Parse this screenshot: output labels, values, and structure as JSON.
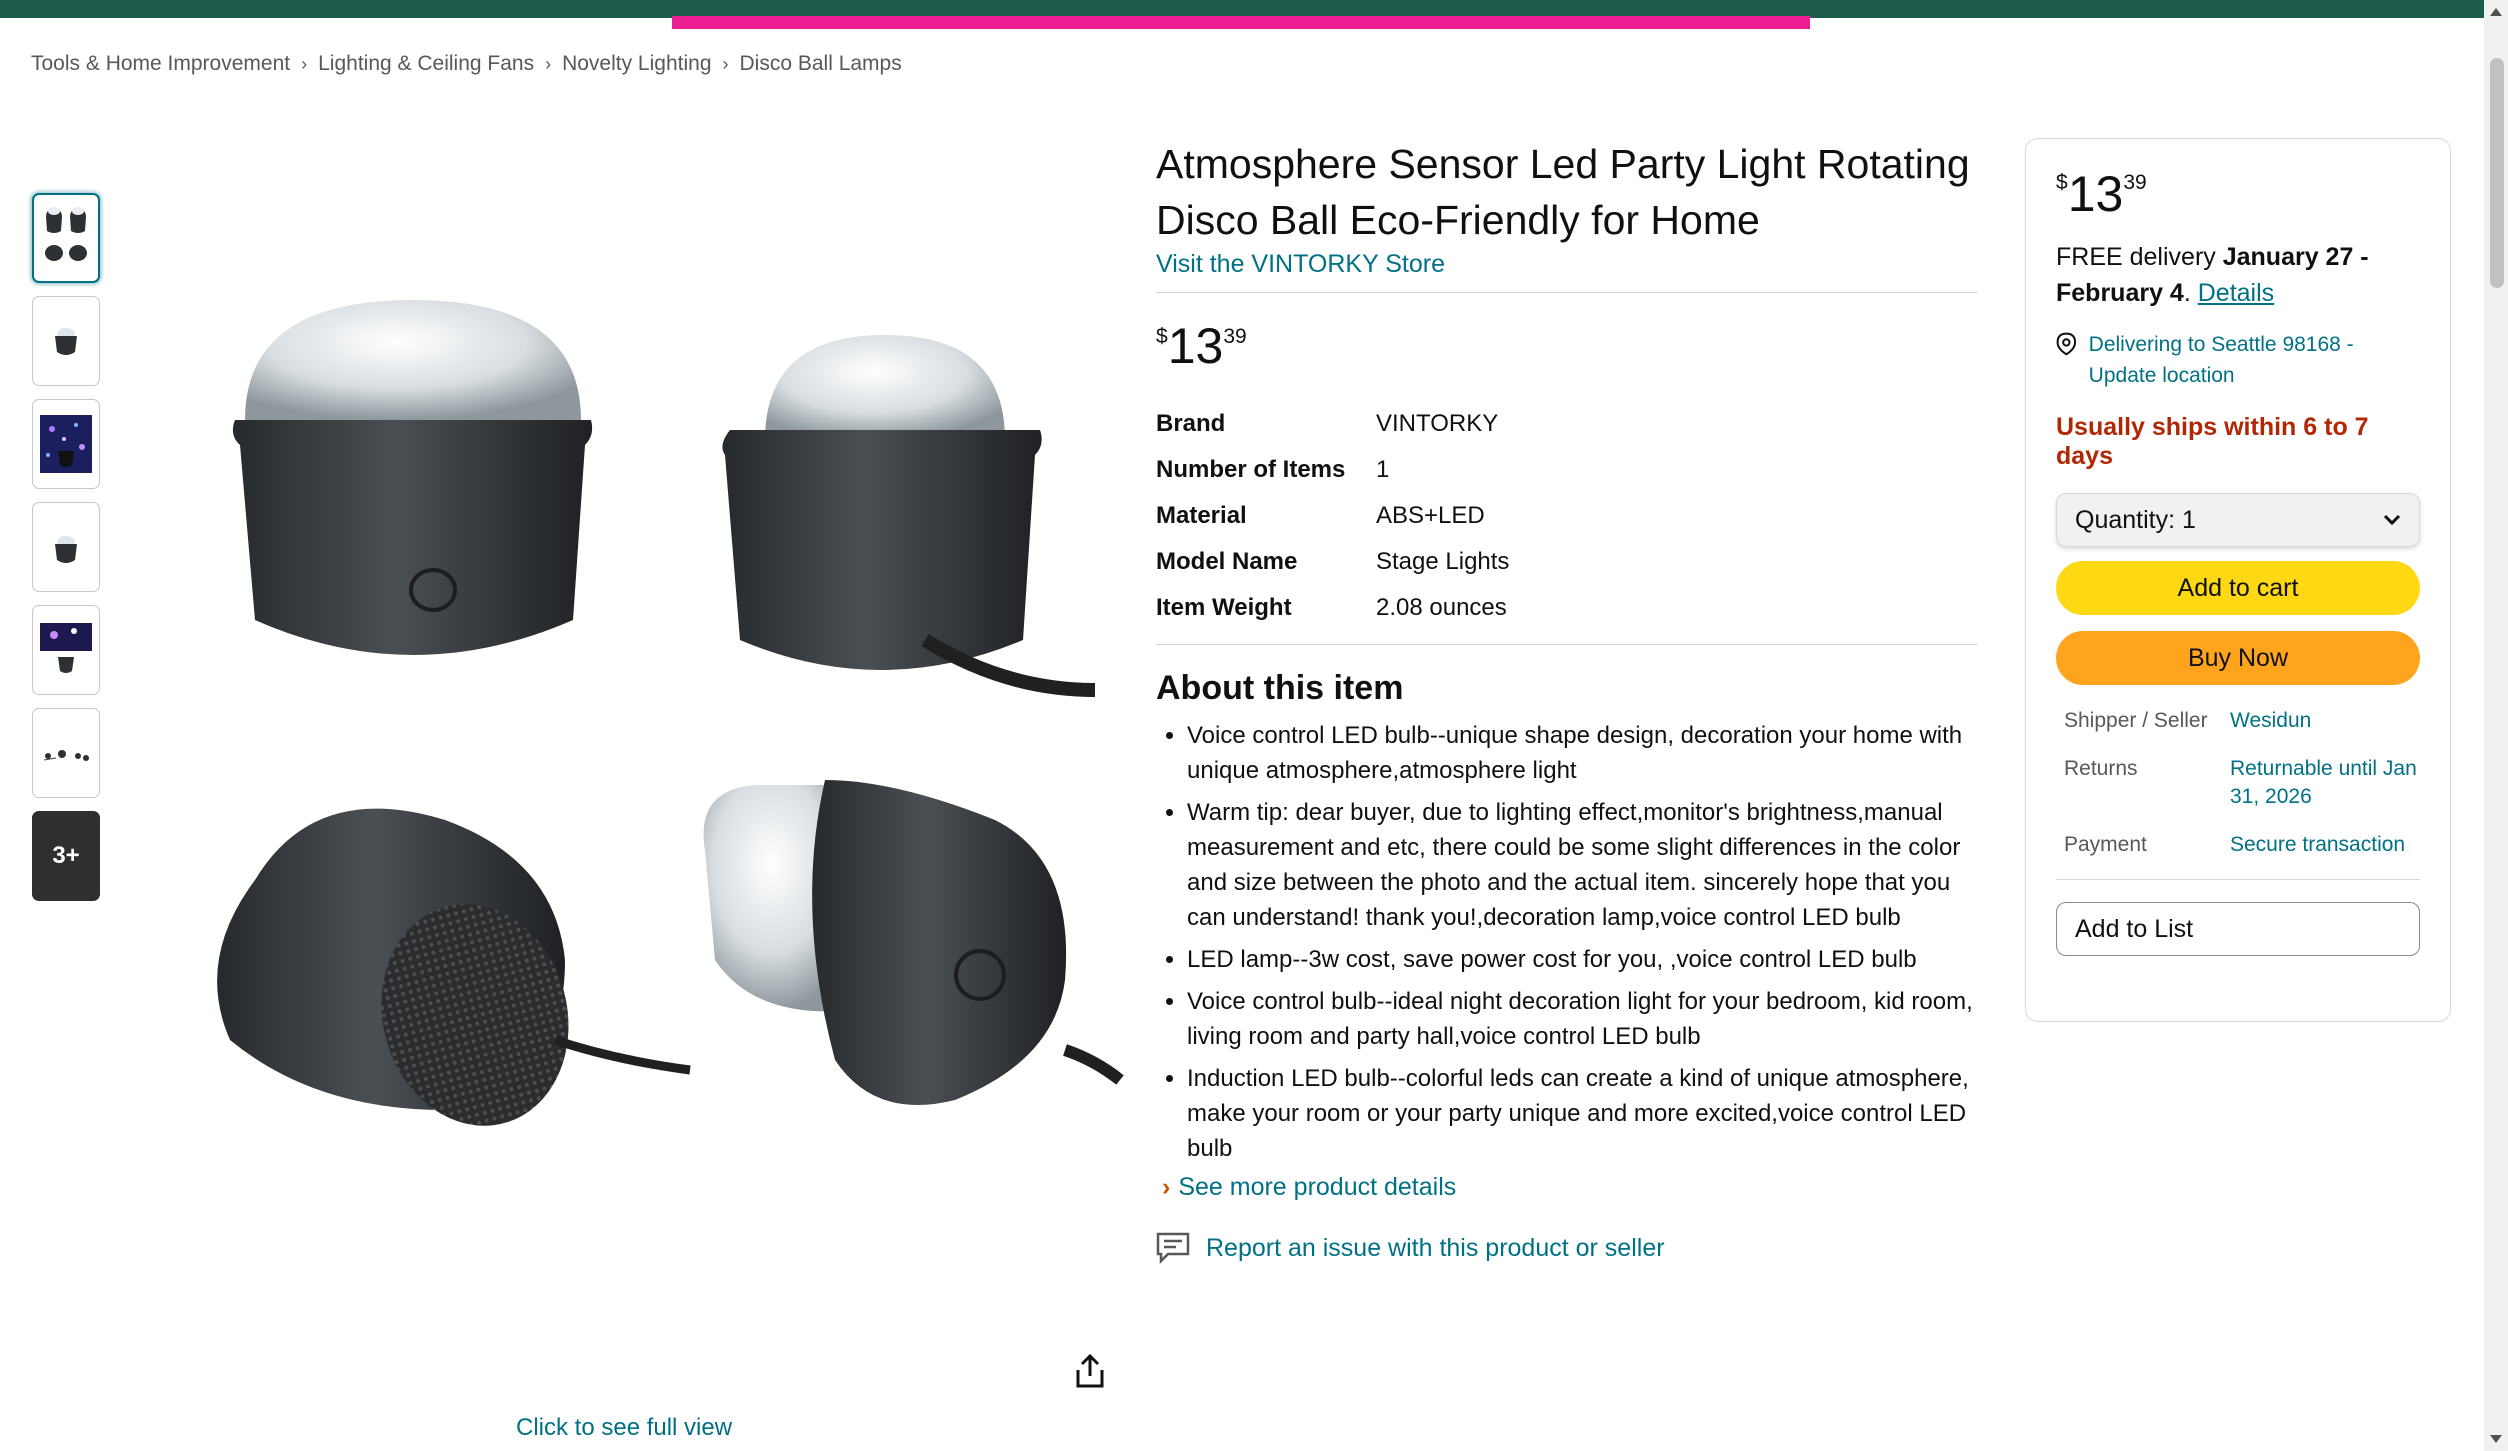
{
  "colors": {
    "top_bar": "#1d5c4a",
    "top_accent": "#ec1d92",
    "link": "#007185",
    "cart_button": "#ffd814",
    "buy_button": "#ffa41c",
    "ships_text": "#b12704"
  },
  "breadcrumb": [
    "Tools & Home Improvement",
    "Lighting & Ceiling Fans",
    "Novelty Lighting",
    "Disco Ball Lamps"
  ],
  "gallery": {
    "thumbnail_more_label": "3+",
    "click_full_view": "Click to see full view"
  },
  "product": {
    "title": "Atmosphere Sensor Led Party Light Rotating Disco Ball Eco-Friendly for Home",
    "store_link": "Visit the VINTORKY Store",
    "price": {
      "symbol": "$",
      "whole": "13",
      "fraction": "39"
    },
    "specs": [
      {
        "label": "Brand",
        "value": "VINTORKY"
      },
      {
        "label": "Number of Items",
        "value": "1"
      },
      {
        "label": "Material",
        "value": "ABS+LED"
      },
      {
        "label": "Model Name",
        "value": "Stage Lights"
      },
      {
        "label": "Item Weight",
        "value": "2.08 ounces"
      }
    ],
    "about_title": "About this item",
    "bullets": [
      "Voice control LED bulb--unique shape design, decoration your home with unique atmosphere,atmosphere light",
      "Warm tip: dear buyer, due to lighting effect,monitor's brightness,manual measurement and etc, there could be some slight differences in the color and size between the photo and the actual item. sincerely hope that you can understand! thank you!,decoration lamp,voice control LED bulb",
      "LED lamp--3w cost, save power cost for you, ,voice control LED bulb",
      "Voice control bulb--ideal night decoration light for your bedroom, kid room, living room and party hall,voice control LED bulb",
      "Induction LED bulb--colorful leds can create a kind of unique atmosphere, make your room or your party unique and more excited,voice control LED bulb"
    ],
    "see_more": "See more product details",
    "report": "Report an issue with this product or seller"
  },
  "buybox": {
    "price": {
      "symbol": "$",
      "whole": "13",
      "fraction": "39"
    },
    "delivery_prefix": "FREE delivery ",
    "delivery_dates": "January 27 - February 4",
    "delivery_suffix": ". ",
    "details_link": "Details",
    "location": "Delivering to Seattle 98168 - Update location",
    "ships": "Usually ships within 6 to 7 days",
    "quantity_label": "Quantity:",
    "quantity_value": "1",
    "add_to_cart": "Add to cart",
    "buy_now": "Buy Now",
    "info": [
      {
        "label": "Shipper / Seller",
        "value": "Wesidun"
      },
      {
        "label": "Returns",
        "value": "Returnable until Jan 31, 2026"
      },
      {
        "label": "Payment",
        "value": "Secure transaction"
      }
    ],
    "add_to_list": "Add to List"
  }
}
